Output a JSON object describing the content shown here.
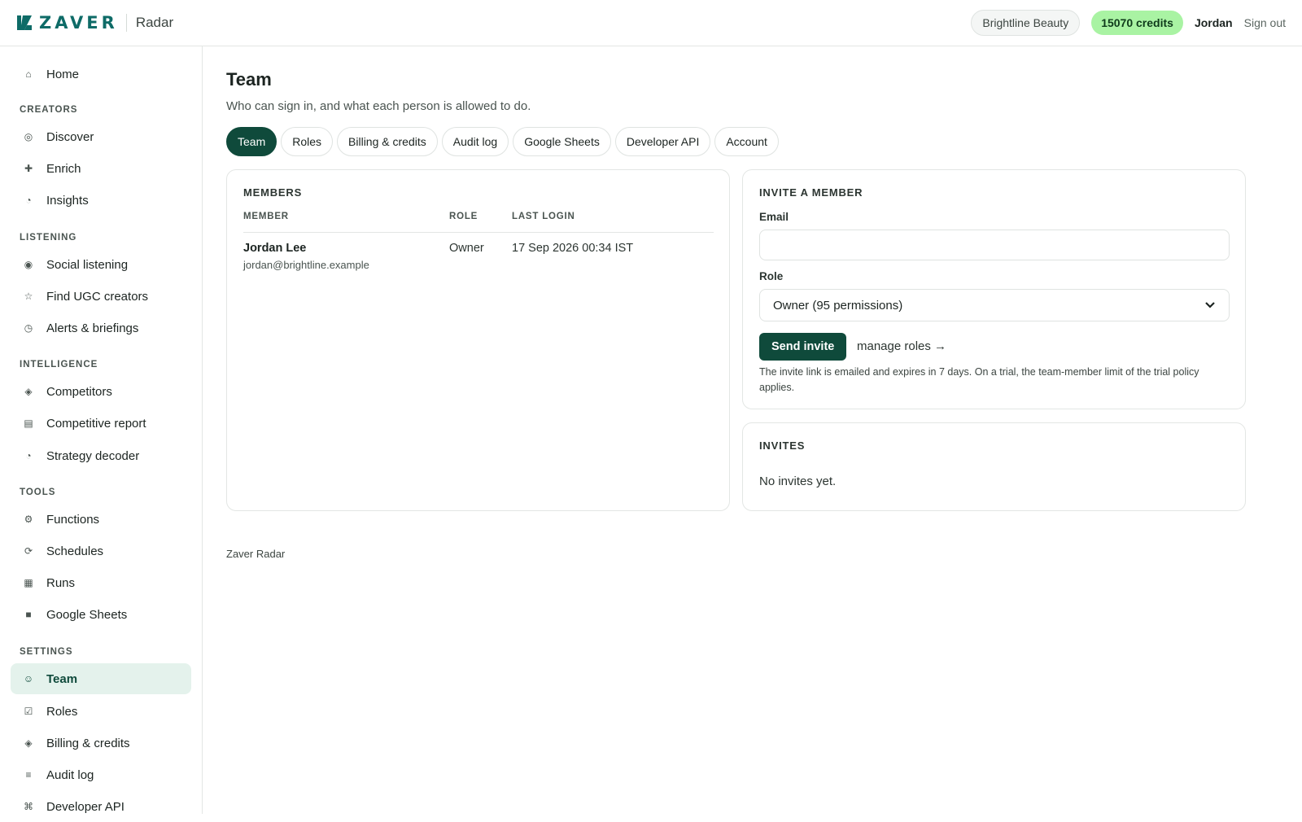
{
  "brand": {
    "logo_text": "ZAVER",
    "product": "Radar"
  },
  "topbar": {
    "org": "Brightline Beauty",
    "credits": "15070 credits",
    "user": "Jordan",
    "sign_out": "Sign out"
  },
  "sidebar": {
    "home": {
      "label": "Home",
      "icon": "home-icon"
    },
    "sections": {
      "creators": "CREATORS",
      "listening": "LISTENING",
      "intelligence": "INTELLIGENCE",
      "tools": "TOOLS",
      "settings": "SETTINGS"
    },
    "items": [
      {
        "label": "Discover",
        "icon": "discover-icon"
      },
      {
        "label": "Enrich",
        "icon": "plus-icon"
      },
      {
        "label": "Insights",
        "icon": "pie-icon"
      },
      {
        "label": "Social listening",
        "icon": "radio-icon"
      },
      {
        "label": "Find UGC creators",
        "icon": "star-icon"
      },
      {
        "label": "Alerts & briefings",
        "icon": "clock-icon"
      },
      {
        "label": "Competitors",
        "icon": "diamond-icon"
      },
      {
        "label": "Competitive report",
        "icon": "report-icon"
      },
      {
        "label": "Strategy decoder",
        "icon": "pie-icon"
      },
      {
        "label": "Functions",
        "icon": "gear-icon"
      },
      {
        "label": "Schedules",
        "icon": "refresh-icon"
      },
      {
        "label": "Runs",
        "icon": "square-icon"
      },
      {
        "label": "Google Sheets",
        "icon": "square-icon"
      },
      {
        "label": "Team",
        "icon": "smile-icon"
      },
      {
        "label": "Roles",
        "icon": "checkbox-icon"
      },
      {
        "label": "Billing & credits",
        "icon": "diamond-icon"
      },
      {
        "label": "Audit log",
        "icon": "list-icon"
      },
      {
        "label": "Developer API",
        "icon": "command-icon"
      }
    ]
  },
  "page": {
    "title": "Team",
    "subtitle": "Who can sign in, and what each person is allowed to do."
  },
  "tabs": [
    "Team",
    "Roles",
    "Billing & credits",
    "Audit log",
    "Google Sheets",
    "Developer API",
    "Account"
  ],
  "members": {
    "title": "MEMBERS",
    "columns": {
      "member": "MEMBER",
      "role": "ROLE",
      "last_login": "LAST LOGIN"
    },
    "rows": [
      {
        "name": "Jordan Lee",
        "email": "jordan@brightline.example",
        "role": "Owner",
        "last_login": "17 Sep 2026 00:34 IST"
      }
    ]
  },
  "invite": {
    "title": "INVITE A MEMBER",
    "email_label": "Email",
    "email_value": "",
    "email_placeholder": "",
    "role_label": "Role",
    "role_selected": "Owner (95 permissions)",
    "send_label": "Send invite",
    "manage_label": "manage roles →",
    "note": "The invite link is emailed and expires in 7 days. On a trial, the team-member limit of the trial policy applies."
  },
  "invites": {
    "title": "INVITES",
    "empty": "No invites yet."
  },
  "footer": "Zaver Radar",
  "colors": {
    "brand_teal": "#0e6b67",
    "primary_dark": "#0f4a3b",
    "credits_bg": "#a9f3a3",
    "active_nav_bg": "#e4f2ec"
  }
}
